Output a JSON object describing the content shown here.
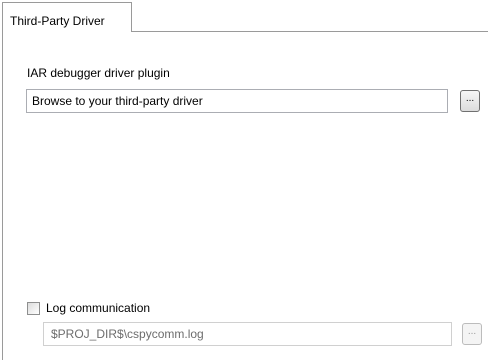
{
  "tabs": [
    {
      "label": "Third-Party Driver",
      "active": true
    }
  ],
  "driver": {
    "label": "IAR debugger driver plugin",
    "value": "Browse to your third-party driver",
    "browse_label": "..."
  },
  "log": {
    "checkbox_label": "Log communication",
    "checked": false,
    "path_value": "$PROJ_DIR$\\cspycomm.log",
    "browse_label": "...",
    "enabled": false
  }
}
